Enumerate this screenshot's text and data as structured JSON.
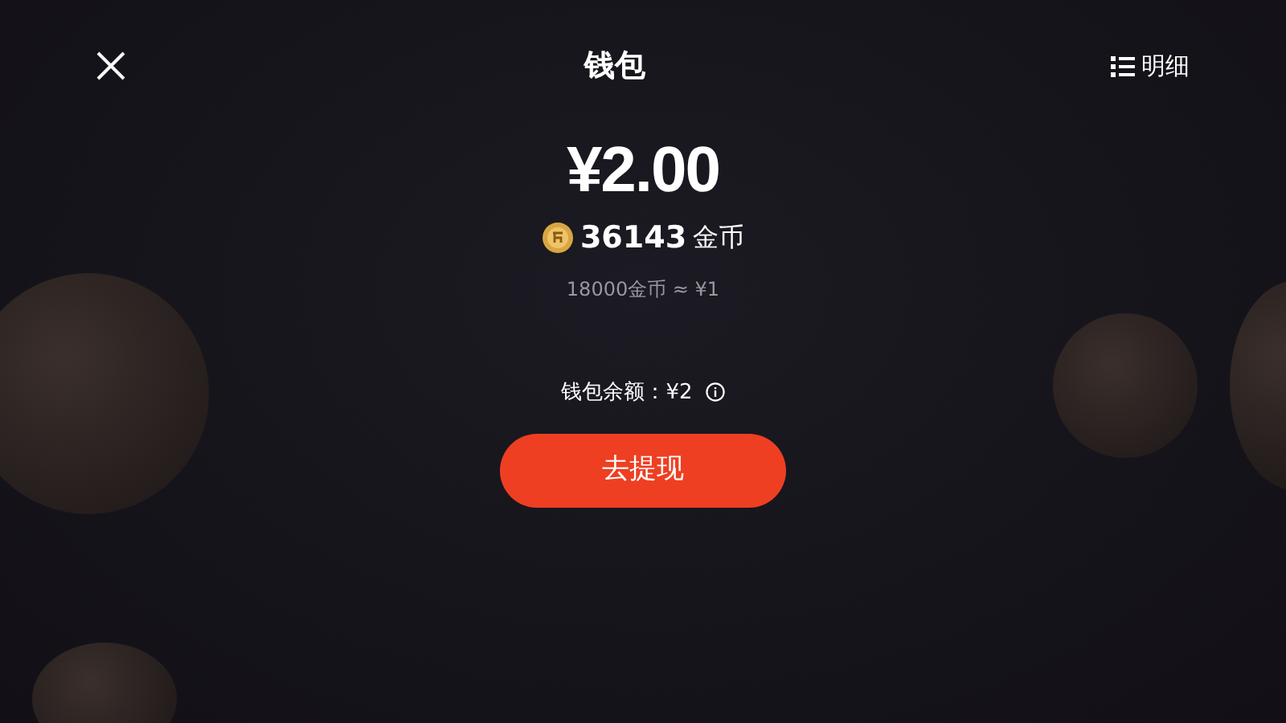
{
  "header": {
    "title": "钱包",
    "details_label": "明细"
  },
  "balance": {
    "amount": "¥2.00",
    "coins": "36143",
    "coins_unit": "金币",
    "rate": "18000金币 ≈ ¥1"
  },
  "wallet_balance": {
    "label": "钱包余额：¥2"
  },
  "withdraw_button": {
    "label": "去提现"
  }
}
